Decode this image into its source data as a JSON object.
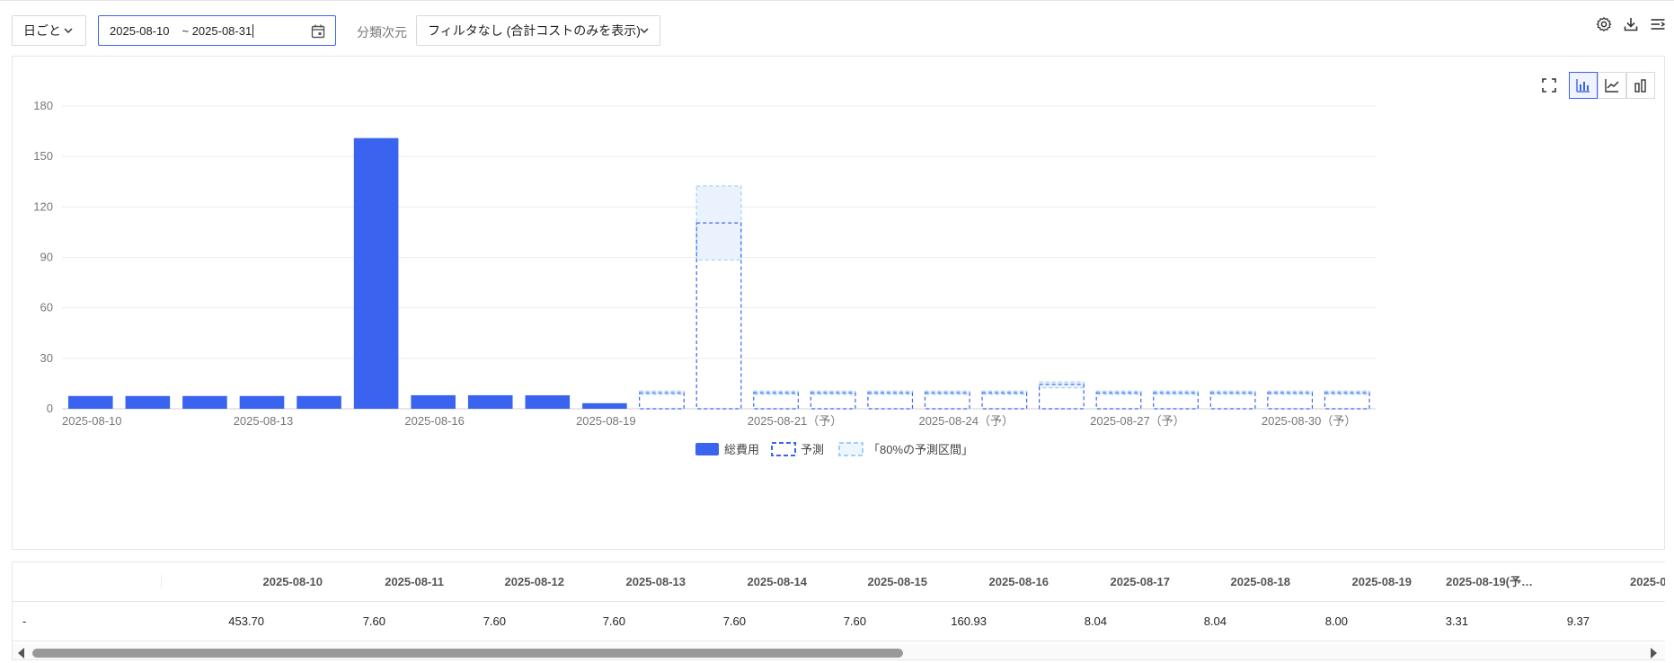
{
  "toolbar": {
    "granularity": "日ごと",
    "date_start": "2025-08-10",
    "date_end": "~ 2025-08-31",
    "dimension_label": "分類次元",
    "dimension_value": "フィルタなし (合計コストのみを表示)",
    "icons": [
      "settings-icon",
      "download-icon",
      "column-settings-icon"
    ]
  },
  "chart_tools": [
    "fullscreen-icon",
    "bar-line-chart-icon",
    "line-chart-icon",
    "bar-chart-icon"
  ],
  "chart_data": {
    "type": "bar",
    "x_labels": [
      "2025-08-10",
      "2025-08-13",
      "2025-08-16",
      "2025-08-19",
      "2025-08-21（予）",
      "2025-08-24（予）",
      "2025-08-27（予）",
      "2025-08-30（予）"
    ],
    "y_ticks": [
      0,
      30,
      60,
      90,
      120,
      150,
      180
    ],
    "ylim": [
      0,
      180
    ],
    "grid": true,
    "legend_position": "bottom",
    "actual": {
      "name": "総費用",
      "color": "#3a64f0",
      "values": [
        7.6,
        7.6,
        7.6,
        7.6,
        7.6,
        160.93,
        8.04,
        8.04,
        8.0,
        3.31
      ]
    },
    "forecast": {
      "name": "予測",
      "color": "#3a64f0",
      "values": [
        9.37,
        110.5,
        9.4,
        9.4,
        9.4,
        9.4,
        9.4,
        14.5,
        9.4,
        9.4,
        9.4,
        9.4,
        9.4
      ]
    },
    "interval": {
      "name": "「80%の予測区間」",
      "color": "#9fd0f7",
      "ranges": [
        [
          8.5,
          10.5
        ],
        [
          88.5,
          132.5
        ],
        [
          8.5,
          10.5
        ],
        [
          8.5,
          10.5
        ],
        [
          8.5,
          10.5
        ],
        [
          8.5,
          10.5
        ],
        [
          8.5,
          10.5
        ],
        [
          12.5,
          16.0
        ],
        [
          8.5,
          10.5
        ],
        [
          8.5,
          10.5
        ],
        [
          8.5,
          10.5
        ],
        [
          8.5,
          10.5
        ],
        [
          8.5,
          10.5
        ]
      ]
    }
  },
  "table": {
    "headers": [
      "",
      "",
      "2025-08-10",
      "2025-08-11",
      "2025-08-12",
      "2025-08-13",
      "2025-08-14",
      "2025-08-15",
      "2025-08-16",
      "2025-08-17",
      "2025-08-18",
      "2025-08-19",
      "2025-08-19(予…",
      "2025-0"
    ],
    "rows": [
      [
        "-",
        "453.70",
        "7.60",
        "7.60",
        "7.60",
        "7.60",
        "7.60",
        "160.93",
        "8.04",
        "8.04",
        "8.00",
        "3.31",
        "9.37",
        ""
      ]
    ]
  }
}
